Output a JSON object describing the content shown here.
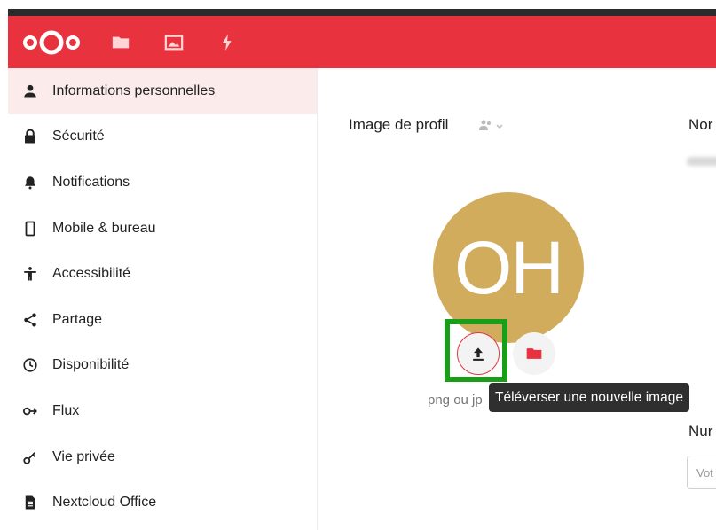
{
  "header": {
    "apps": [
      {
        "icon": "folder-icon"
      },
      {
        "icon": "photos-icon"
      },
      {
        "icon": "activity-icon"
      }
    ],
    "accent_color": "#e8333f"
  },
  "sidebar": {
    "items": [
      {
        "label": "Informations personnelles",
        "icon": "user-icon",
        "active": true
      },
      {
        "label": "Sécurité",
        "icon": "lock-icon"
      },
      {
        "label": "Notifications",
        "icon": "bell-icon"
      },
      {
        "label": "Mobile & bureau",
        "icon": "phone-icon"
      },
      {
        "label": "Accessibilité",
        "icon": "accessibility-icon"
      },
      {
        "label": "Partage",
        "icon": "share-icon"
      },
      {
        "label": "Disponibilité",
        "icon": "clock-icon"
      },
      {
        "label": "Flux",
        "icon": "flux-icon"
      },
      {
        "label": "Vie privée",
        "icon": "key-icon"
      },
      {
        "label": "Nextcloud Office",
        "icon": "document-icon"
      }
    ]
  },
  "profile": {
    "heading": "Image de profil",
    "avatar_initials": "OH",
    "avatar_color": "#d0ac5c",
    "hint": "png ou jp",
    "tooltip": "Téléverser une nouvelle image"
  },
  "right_column": {
    "name_label": "Nor",
    "number_label": "Nur",
    "input_placeholder": "Vot"
  },
  "colors": {
    "highlight": "#1a9e1a",
    "active_item_bg": "#fcebeb"
  }
}
